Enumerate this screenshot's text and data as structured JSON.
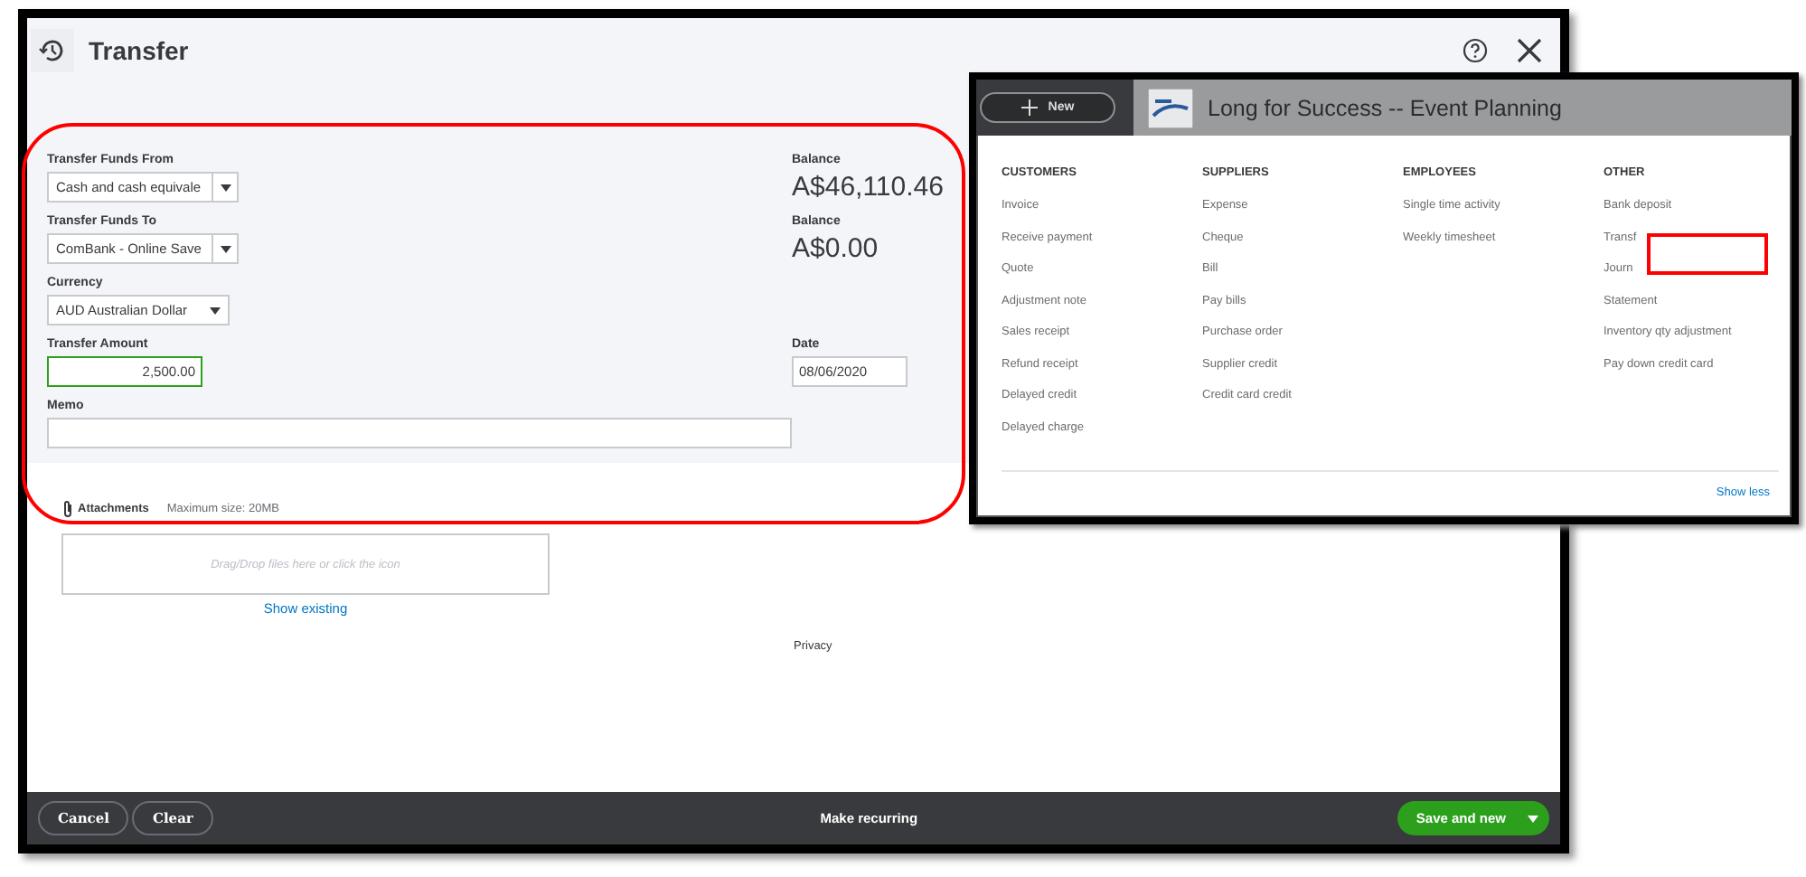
{
  "window": {
    "title": "Transfer"
  },
  "fields": [
    {
      "kind": "account",
      "label": "Transfer Funds From",
      "value": "Cash and cash equivale",
      "side_label": "Balance",
      "side_value": "A$46,110.46"
    },
    {
      "kind": "account",
      "label": "Transfer Funds To",
      "value": "ComBank - Online Save",
      "side_label": "Balance",
      "side_value": "A$0.00"
    },
    {
      "kind": "select",
      "label": "Currency",
      "value": "AUD Australian Dollar"
    },
    {
      "kind": "amount",
      "label": "Transfer Amount",
      "value": "2,500.00",
      "focused": true,
      "side_label": "Date",
      "side_value": "08/06/2020"
    },
    {
      "kind": "text",
      "label": "Memo"
    }
  ],
  "attachments": {
    "label": "Attachments",
    "max_size": "Maximum size: 20MB",
    "drop_hint": "Drag/Drop files here or click the icon",
    "link": "Show existing"
  },
  "privacy": "Privacy",
  "footer": {
    "buttons": [
      "Cancel",
      "Clear"
    ],
    "center": "Make recurring",
    "primary": "Save and new"
  },
  "new_menu": {
    "new_button": "New",
    "company": "Long for Success -- Event Planning",
    "columns": [
      {
        "heading": "CUSTOMERS",
        "items": [
          "Invoice",
          "Receive payment",
          "Quote",
          "Adjustment note",
          "Sales receipt",
          "Refund receipt",
          "Delayed credit",
          "Delayed charge"
        ]
      },
      {
        "heading": "SUPPLIERS",
        "items": [
          "Expense",
          "Cheque",
          "Bill",
          "Pay bills",
          "Purchase order",
          "Supplier credit",
          "Credit card credit"
        ]
      },
      {
        "heading": "EMPLOYEES",
        "items": [
          "Single time activity",
          "Weekly timesheet"
        ]
      },
      {
        "heading": "OTHER",
        "items": [
          "Bank deposit",
          "Transf",
          "Journ",
          "Statement",
          "Inventory qty adjustment",
          "Pay down credit card"
        ]
      }
    ],
    "show_less": "Show less"
  },
  "annotations": {
    "form_ellipse": true,
    "menu_rectangle": true
  }
}
